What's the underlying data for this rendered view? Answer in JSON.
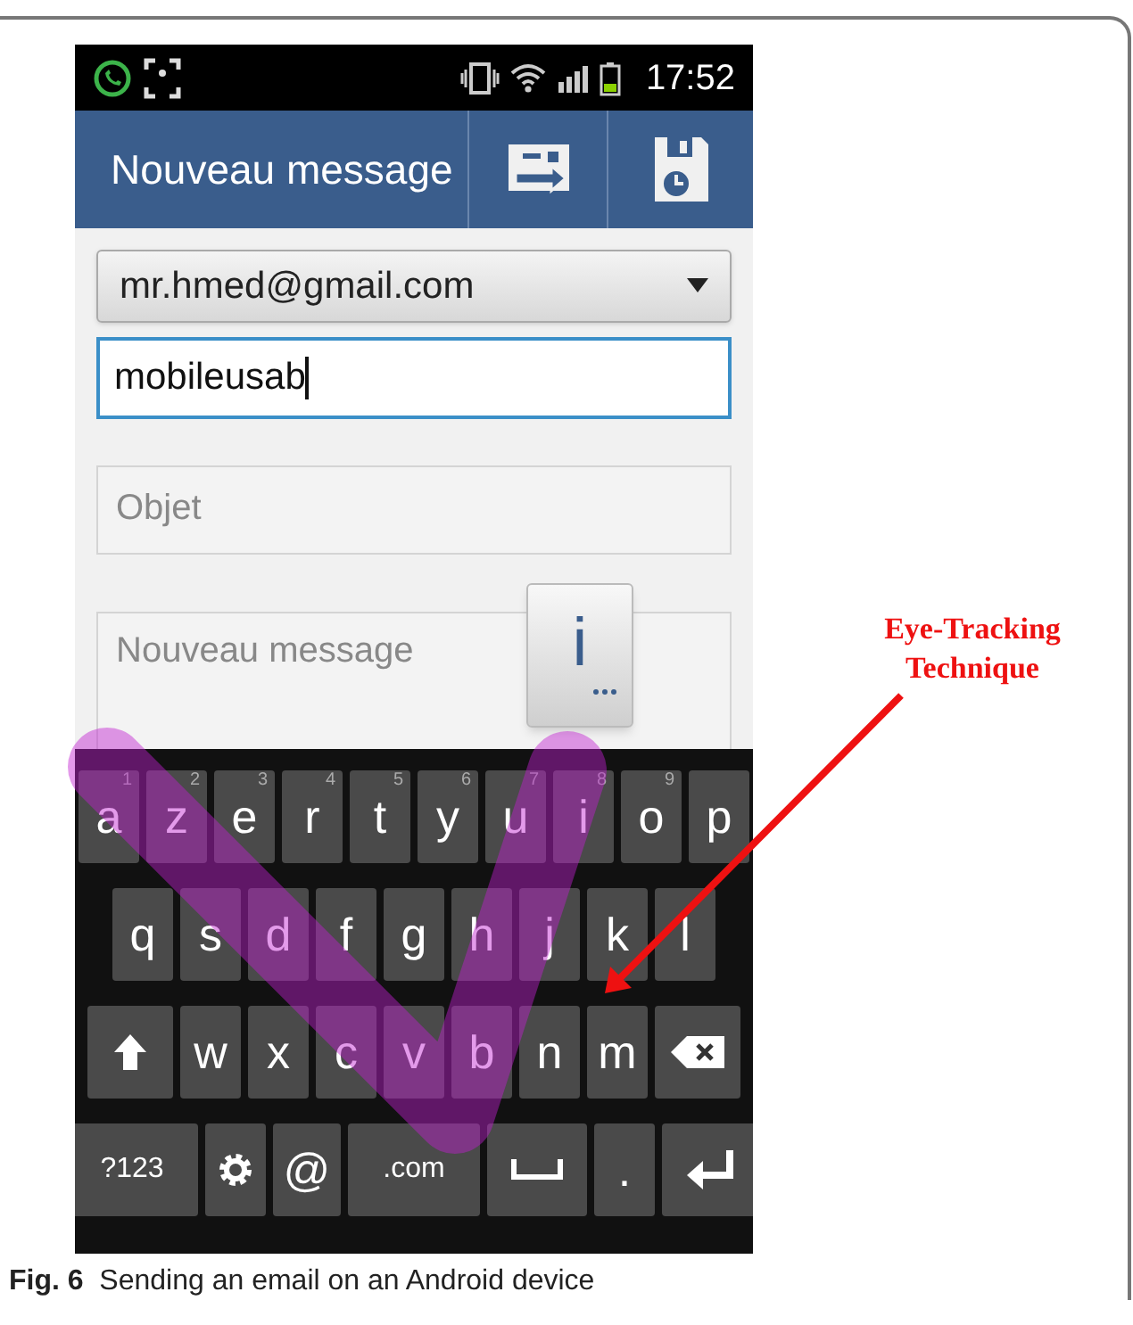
{
  "status_bar": {
    "time": "17:52"
  },
  "action_bar": {
    "title": "Nouveau message"
  },
  "form": {
    "account": "mr.hmed@gmail.com",
    "to": {
      "value": "mobileusab",
      "focused": true
    },
    "subject": {
      "placeholder": "Objet"
    },
    "body": {
      "placeholder": "Nouveau message"
    }
  },
  "key_popup": {
    "label": "i"
  },
  "keyboard": {
    "rows": [
      {
        "keys": [
          {
            "kind": "char",
            "label": "a",
            "hint": "1"
          },
          {
            "kind": "char",
            "label": "z",
            "hint": "2"
          },
          {
            "kind": "char",
            "label": "e",
            "hint": "3"
          },
          {
            "kind": "char",
            "label": "r",
            "hint": "4"
          },
          {
            "kind": "char",
            "label": "t",
            "hint": "5"
          },
          {
            "kind": "char",
            "label": "y",
            "hint": "6"
          },
          {
            "kind": "char",
            "label": "u",
            "hint": "7"
          },
          {
            "kind": "char",
            "label": "i",
            "hint": "8"
          },
          {
            "kind": "char",
            "label": "o",
            "hint": "9"
          },
          {
            "kind": "char",
            "label": "p"
          }
        ]
      },
      {
        "keys": [
          {
            "kind": "char",
            "label": "q"
          },
          {
            "kind": "char",
            "label": "s"
          },
          {
            "kind": "char",
            "label": "d"
          },
          {
            "kind": "char",
            "label": "f"
          },
          {
            "kind": "char",
            "label": "g"
          },
          {
            "kind": "char",
            "label": "h"
          },
          {
            "kind": "char",
            "label": "j"
          },
          {
            "kind": "char",
            "label": "k"
          },
          {
            "kind": "char",
            "label": "l"
          }
        ]
      },
      {
        "keys": [
          {
            "kind": "shift"
          },
          {
            "kind": "char",
            "label": "w"
          },
          {
            "kind": "char",
            "label": "x"
          },
          {
            "kind": "char",
            "label": "c"
          },
          {
            "kind": "char",
            "label": "v"
          },
          {
            "kind": "char",
            "label": "b"
          },
          {
            "kind": "char",
            "label": "n"
          },
          {
            "kind": "char",
            "label": "m"
          },
          {
            "kind": "backspace"
          }
        ]
      },
      {
        "keys": [
          {
            "kind": "wide",
            "label": "?123"
          },
          {
            "kind": "settings"
          },
          {
            "kind": "char",
            "label": "@"
          },
          {
            "kind": "wide",
            "label": ".com"
          },
          {
            "kind": "space"
          },
          {
            "kind": "char",
            "label": "."
          },
          {
            "kind": "enter"
          }
        ]
      }
    ]
  },
  "annotation": {
    "label": "Eye-Tracking Technique"
  },
  "caption": "**Fig. 6**  Sending an email on an Android device"
}
